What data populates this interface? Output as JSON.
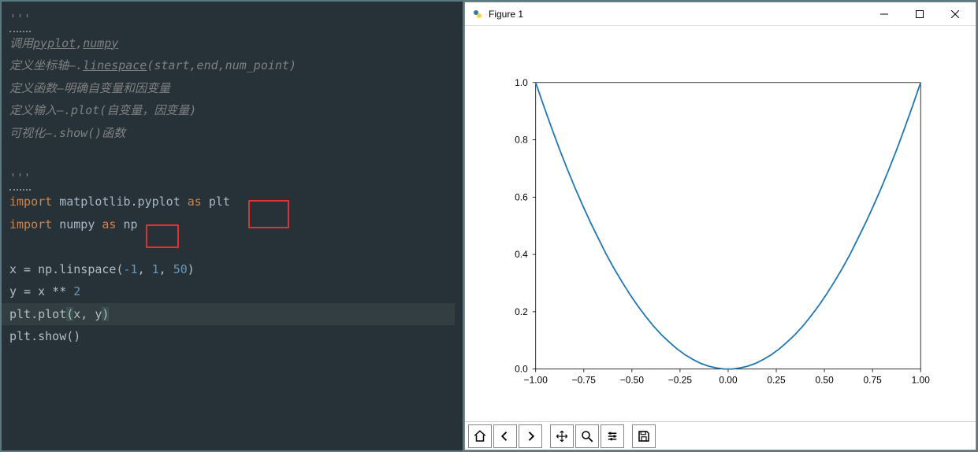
{
  "editor": {
    "lines": {
      "docstring_open": "'''",
      "c1": "调用pyplot,numpy",
      "c2_pre": "定义坐标轴—.",
      "c2_fn": "linespace",
      "c2_args": "(start,end,num_point)",
      "c3": "定义函数—明确自变量和因变量",
      "c4": "定义输入—.plot(自变量，因变量)",
      "c5": "可视化—.show()函数",
      "docstring_close": "'''",
      "import1_kw": "import",
      "import1_mod": " matplotlib.pyplot ",
      "import1_as": "as",
      "import1_alias": " plt",
      "import2_kw": "import",
      "import2_mod": " numpy ",
      "import2_as": "as",
      "import2_alias": " np",
      "l1_pre": "x = np.linspace(",
      "l1_n1": "-1",
      "l1_c1": ", ",
      "l1_n2": "1",
      "l1_c2": ", ",
      "l1_n3": "50",
      "l1_post": ")",
      "l2_pre": "y = x ** ",
      "l2_n": "2",
      "l3_pre": "plt.plot",
      "l3_open": "(",
      "l3_args": "x, y",
      "l3_close": ")",
      "l4": "plt.show()"
    }
  },
  "figure": {
    "title": "Figure 1",
    "toolbar": {
      "home": "home-icon",
      "back": "back-icon",
      "forward": "forward-icon",
      "pan": "pan-icon",
      "zoom": "zoom-icon",
      "config": "subplots-icon",
      "save": "save-icon"
    }
  },
  "chart_data": {
    "type": "line",
    "x": [
      -1.0,
      -0.959,
      -0.918,
      -0.878,
      -0.837,
      -0.796,
      -0.755,
      -0.714,
      -0.673,
      -0.633,
      -0.592,
      -0.551,
      -0.51,
      -0.469,
      -0.429,
      -0.388,
      -0.347,
      -0.306,
      -0.265,
      -0.224,
      -0.184,
      -0.143,
      -0.102,
      -0.061,
      -0.02,
      0.02,
      0.061,
      0.102,
      0.143,
      0.184,
      0.224,
      0.265,
      0.306,
      0.347,
      0.388,
      0.429,
      0.469,
      0.51,
      0.551,
      0.592,
      0.633,
      0.673,
      0.714,
      0.755,
      0.796,
      0.837,
      0.878,
      0.918,
      0.959,
      1.0
    ],
    "y": [
      1.0,
      0.92,
      0.843,
      0.77,
      0.7,
      0.633,
      0.57,
      0.51,
      0.454,
      0.4,
      0.35,
      0.304,
      0.26,
      0.22,
      0.184,
      0.15,
      0.12,
      0.094,
      0.07,
      0.05,
      0.034,
      0.02,
      0.01,
      0.004,
      0.0,
      0.0,
      0.004,
      0.01,
      0.02,
      0.034,
      0.05,
      0.07,
      0.094,
      0.12,
      0.15,
      0.184,
      0.22,
      0.26,
      0.304,
      0.35,
      0.4,
      0.454,
      0.51,
      0.57,
      0.633,
      0.7,
      0.77,
      0.843,
      0.92,
      1.0
    ],
    "xlim": [
      -1.0,
      1.0
    ],
    "ylim": [
      0.0,
      1.0
    ],
    "xticks": [
      -1.0,
      -0.75,
      -0.5,
      -0.25,
      0.0,
      0.25,
      0.5,
      0.75,
      1.0
    ],
    "yticks": [
      0.0,
      0.2,
      0.4,
      0.6,
      0.8,
      1.0
    ],
    "xtick_labels": [
      "−1.00",
      "−0.75",
      "−0.50",
      "−0.25",
      "0.00",
      "0.25",
      "0.50",
      "0.75",
      "1.00"
    ],
    "ytick_labels": [
      "0.0",
      "0.2",
      "0.4",
      "0.6",
      "0.8",
      "1.0"
    ],
    "title": "",
    "xlabel": "",
    "ylabel": ""
  }
}
